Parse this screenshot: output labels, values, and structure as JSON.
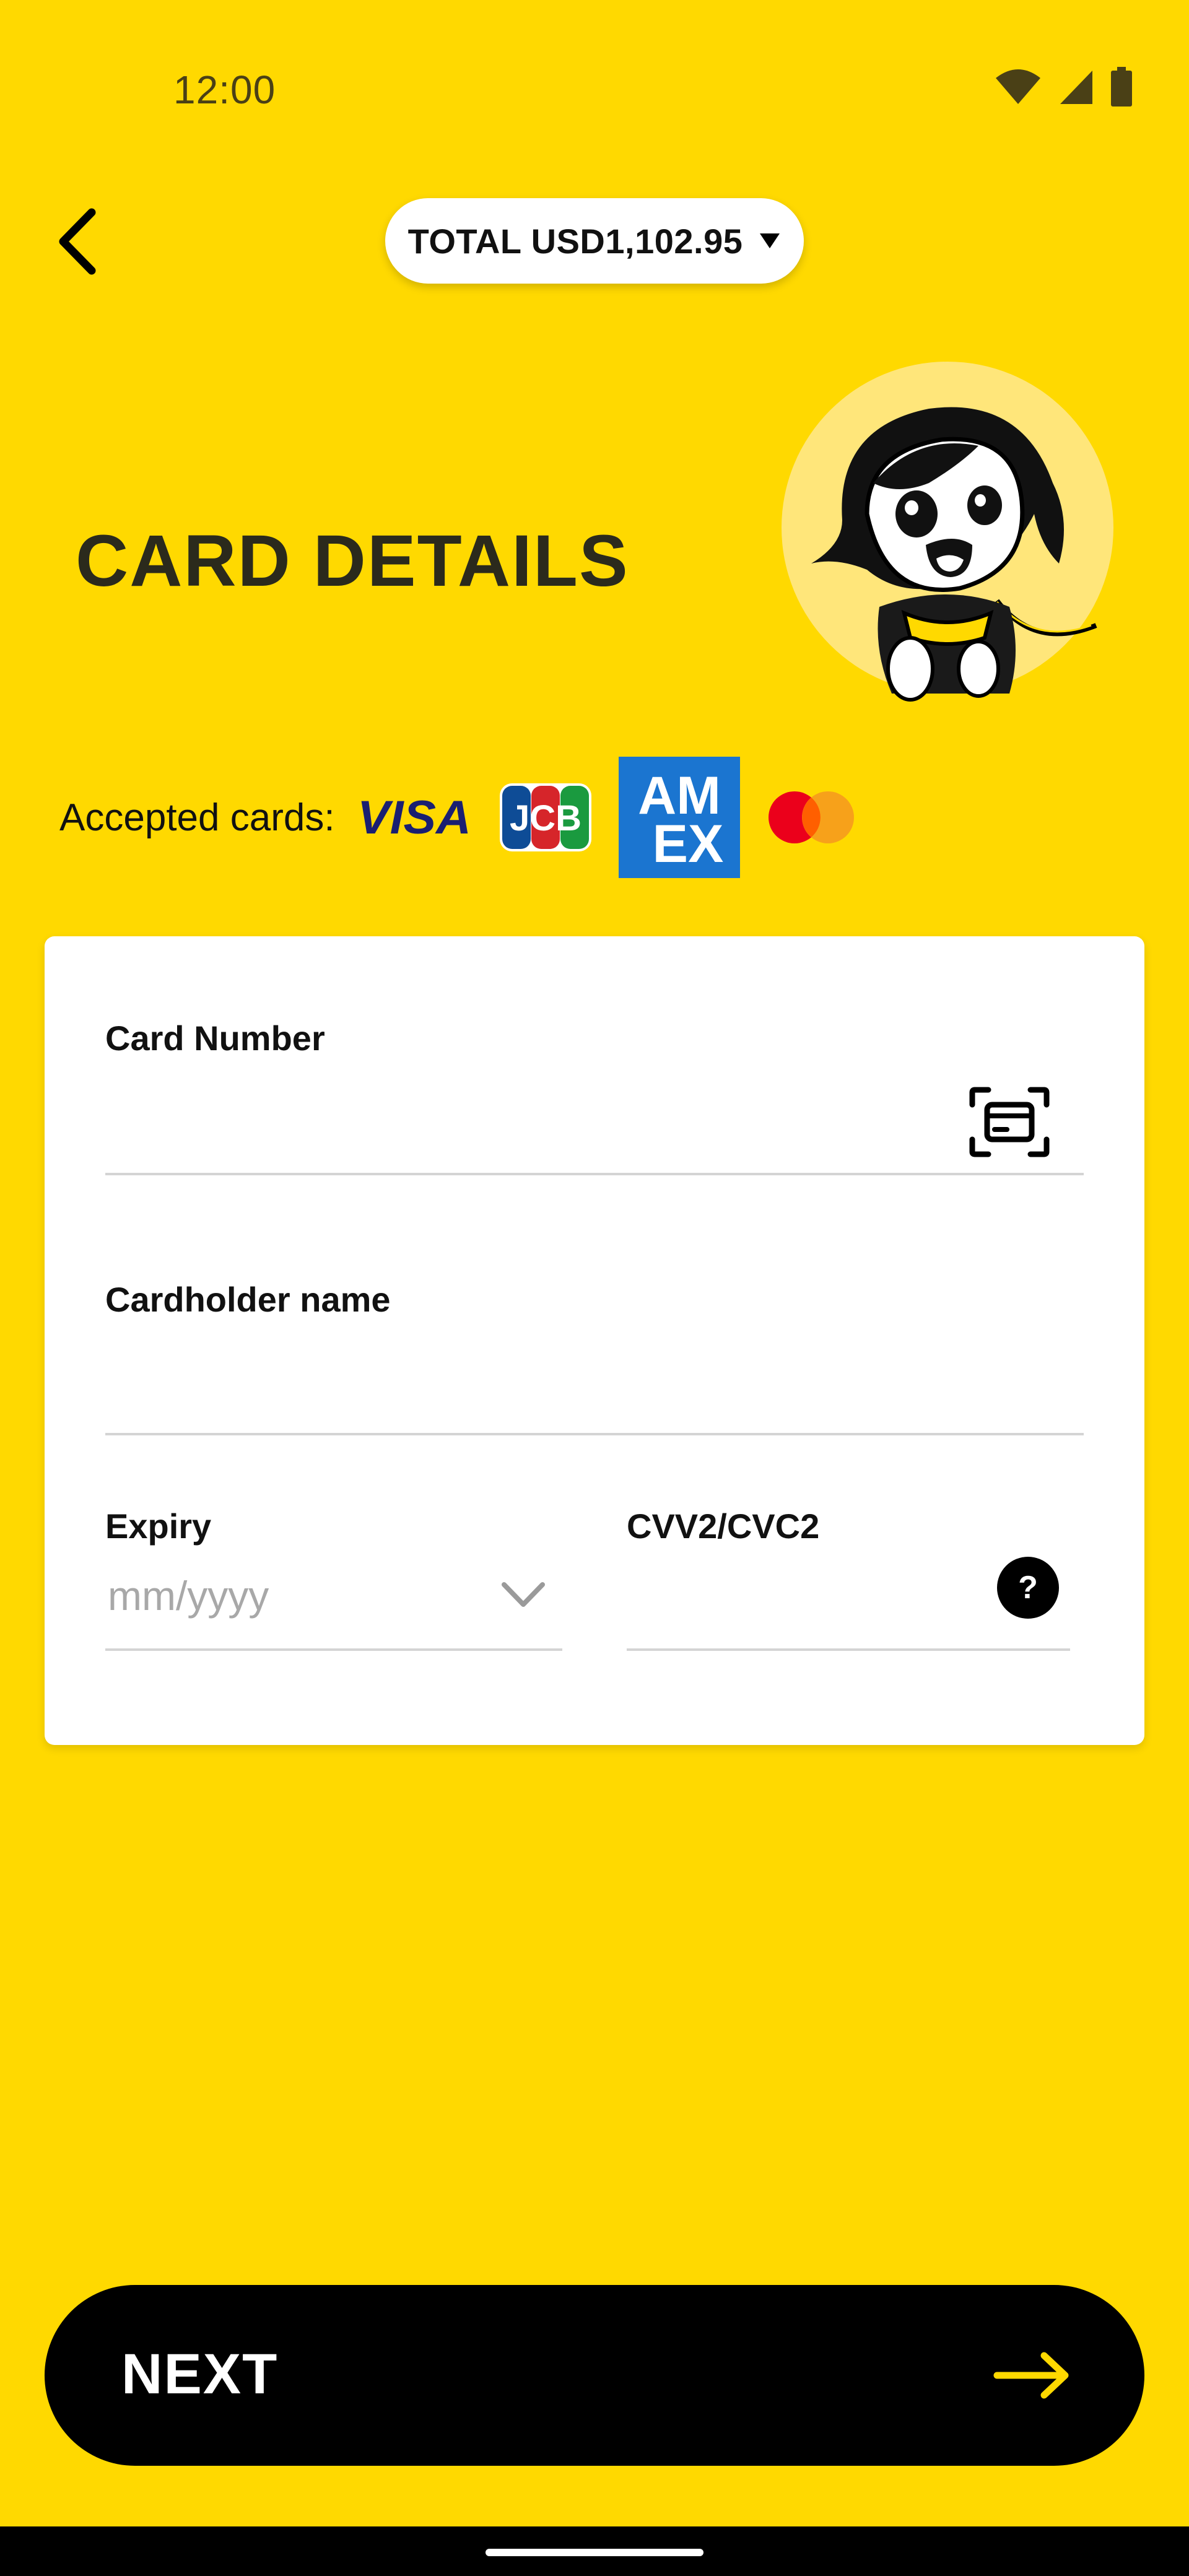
{
  "status_bar": {
    "time": "12:00",
    "icons": [
      "wifi-icon",
      "signal-icon",
      "battery-icon"
    ]
  },
  "header": {
    "back_icon": "chevron-left-icon",
    "total_label": "TOTAL USD1,102.95",
    "dropdown_icon": "caret-down-icon"
  },
  "page": {
    "title": "CARD DETAILS",
    "mascot": "mascot-illustration"
  },
  "accepted_cards": {
    "label": "Accepted cards:",
    "brands": [
      "VISA",
      "JCB",
      "AMEX",
      "Mastercard"
    ],
    "visa_text": "VISA",
    "jcb_text": "JCB",
    "amex_line1": "AM",
    "amex_line2": "EX"
  },
  "form": {
    "card_number": {
      "label": "Card Number",
      "value": "",
      "scan_icon": "card-scan-icon"
    },
    "cardholder_name": {
      "label": "Cardholder name",
      "value": ""
    },
    "expiry": {
      "label": "Expiry",
      "placeholder": "mm/yyyy",
      "dropdown_icon": "chevron-down-icon"
    },
    "cvv": {
      "label": "CVV2/CVC2",
      "value": "",
      "help_icon": "help-icon",
      "help_text": "?"
    }
  },
  "footer": {
    "next_label": "NEXT",
    "next_icon": "arrow-right-icon"
  },
  "colors": {
    "background": "#FFD900",
    "button": "#000000",
    "accent_arrow": "#FFD900",
    "amex_blue": "#1B75D0"
  }
}
